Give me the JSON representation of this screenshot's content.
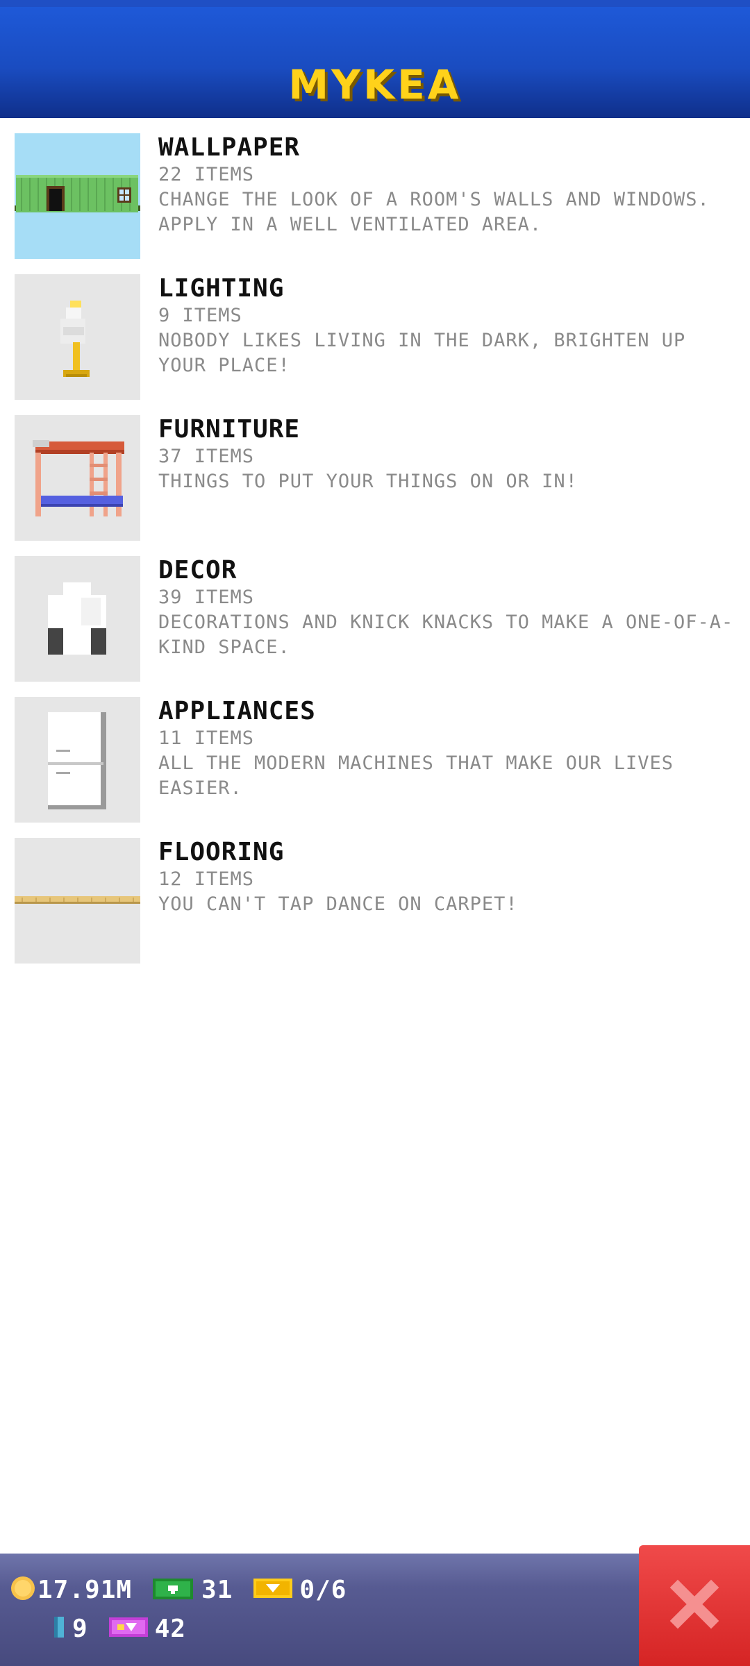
{
  "header": {
    "title": "MYKEA"
  },
  "categories": [
    {
      "name": "WALLPAPER",
      "count": "22 ITEMS",
      "desc": "CHANGE THE LOOK OF A ROOM'S WALLS AND WINDOWS. APPLY IN A WELL VENTILATED AREA.",
      "icon": "wallpaper-icon"
    },
    {
      "name": "LIGHTING",
      "count": "9 ITEMS",
      "desc": "NOBODY LIKES LIVING IN THE DARK, BRIGHTEN UP YOUR PLACE!",
      "icon": "lamp-icon"
    },
    {
      "name": "FURNITURE",
      "count": "37 ITEMS",
      "desc": "THINGS TO PUT YOUR THINGS ON OR IN!",
      "icon": "bunk-bed-icon"
    },
    {
      "name": "DECOR",
      "count": "39 ITEMS",
      "desc": "DECORATIONS AND KNICK KNACKS TO MAKE A ONE-OF-A-KIND SPACE.",
      "icon": "decor-icon"
    },
    {
      "name": "APPLIANCES",
      "count": "11 ITEMS",
      "desc": "ALL THE MODERN MACHINES THAT MAKE OUR LIVES EASIER.",
      "icon": "fridge-icon"
    },
    {
      "name": "FLOORING",
      "count": "12 ITEMS",
      "desc": "YOU CAN'T TAP DANCE ON CARPET!",
      "icon": "flooring-icon"
    }
  ],
  "footer": {
    "coins": "17.91M",
    "bux": "31",
    "tickets": "0/6",
    "bits": "9",
    "vip": "42"
  },
  "colors": {
    "header": "#1a4cc0",
    "title": "#ffd21a",
    "footer": "#575b92",
    "close": "#e03030"
  }
}
